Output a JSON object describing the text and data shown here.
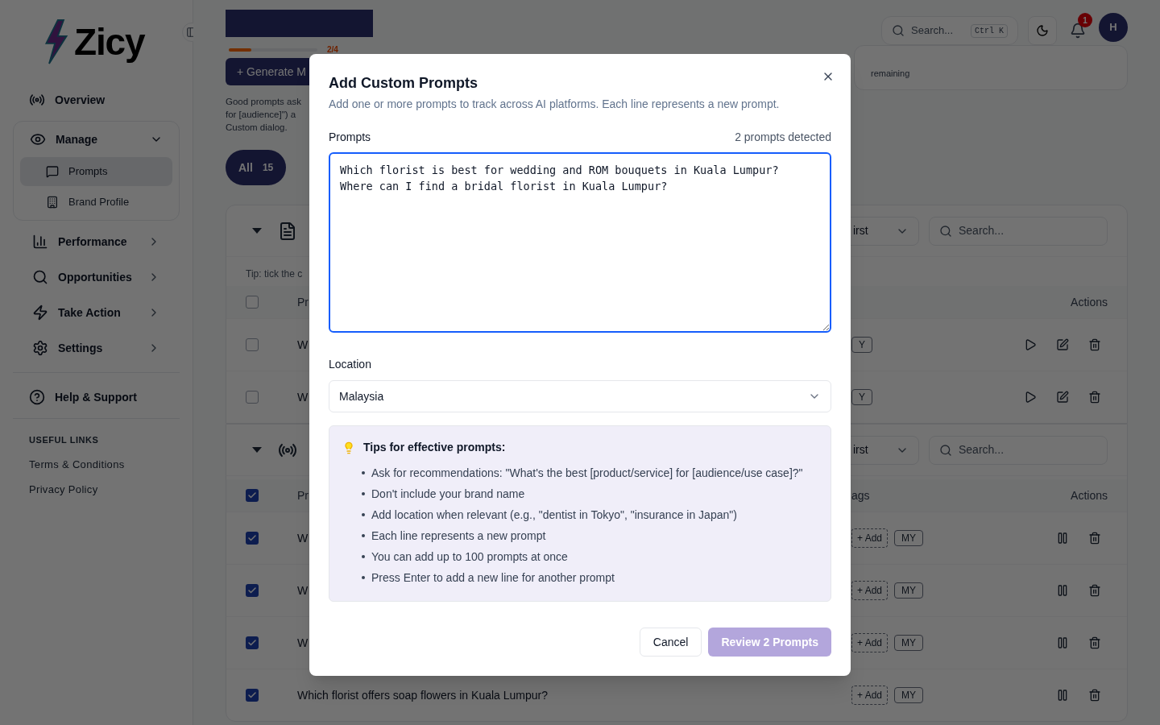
{
  "sidebar": {
    "logo": "Zicy",
    "items": [
      {
        "label": "Overview",
        "kind": "link"
      },
      {
        "label": "Manage",
        "kind": "group",
        "expanded": true,
        "children": [
          {
            "label": "Prompts",
            "selected": true
          },
          {
            "label": "Brand Profile",
            "selected": false
          }
        ]
      },
      {
        "label": "Performance",
        "kind": "menu"
      },
      {
        "label": "Opportunities",
        "kind": "menu"
      },
      {
        "label": "Take Action",
        "kind": "menu"
      },
      {
        "label": "Settings",
        "kind": "menu"
      },
      {
        "label": "Help & Support",
        "kind": "link"
      }
    ],
    "links_heading": "USEFUL LINKS",
    "links": [
      "Terms & Conditions",
      "Privacy Policy"
    ]
  },
  "header": {
    "progress_reading": "2/4",
    "progress": {
      "level": 0.25
    },
    "search": {
      "placeholder": "Search...",
      "shortcut": "Ctrl K"
    },
    "notifications": "1",
    "avatar": "H"
  },
  "main": {
    "quota_note": "remaining",
    "generate_button": "+ Generate M",
    "hint_lines": [
      "Good prompts ask",
      "for [audience]\") a",
      "Custom dialog."
    ],
    "filters": [
      {
        "label": "All",
        "count": "15",
        "selected": true
      }
    ],
    "groups": [
      {
        "kind": "stopped",
        "sort": "irst",
        "search_placeholder": "Search...",
        "tip": "Tip: tick the c",
        "header_checked": false,
        "columns": [
          "Pr",
          "Actions"
        ],
        "rows": [
          {
            "checked": false,
            "text": "W",
            "tags": [
              "Y"
            ]
          },
          {
            "checked": false,
            "text": "W",
            "tags": [
              "Y"
            ]
          }
        ]
      },
      {
        "kind": "running",
        "sort": "irst",
        "search_placeholder": "Search...",
        "header_checked": true,
        "columns": [
          "Pr",
          "ags",
          "Actions"
        ],
        "rows": [
          {
            "checked": true,
            "text": "W",
            "add": "+ Add",
            "tags": [
              "MY"
            ]
          },
          {
            "checked": true,
            "text": "W",
            "add": "+ Add",
            "tags": [
              "MY"
            ]
          },
          {
            "checked": true,
            "text": "W",
            "add": "+ Add",
            "tags": [
              "MY"
            ]
          },
          {
            "checked": true,
            "text": "Which florist offers soap flowers in Kuala Lumpur?",
            "add": "+ Add",
            "tags": [
              "MY"
            ]
          }
        ]
      }
    ]
  },
  "dialog": {
    "title": "Add Custom Prompts",
    "description": "Add one or more prompts to track across AI platforms. Each line represents a new prompt.",
    "prompts_label": "Prompts",
    "detected": "2 prompts detected",
    "prompts_value": "Which florist is best for wedding and ROM bouquets in Kuala Lumpur?\nWhere can I find a bridal florist in Kuala Lumpur?",
    "location_label": "Location",
    "location": "Malaysia",
    "tips_title": "Tips for effective prompts:",
    "tips": [
      "Ask for recommendations: \"What's the best [product/service] for [audience/use case]?\"",
      "Don't include your brand name",
      "Add location when relevant (e.g., \"dentist in Tokyo\", \"insurance in Japan\")",
      "Each line represents a new prompt",
      "You can add up to 100 prompts at once",
      "Press Enter to add a new line for another prompt"
    ],
    "cancel": "Cancel",
    "submit": {
      "label": "Review 2 Prompts",
      "disabled": true
    }
  }
}
